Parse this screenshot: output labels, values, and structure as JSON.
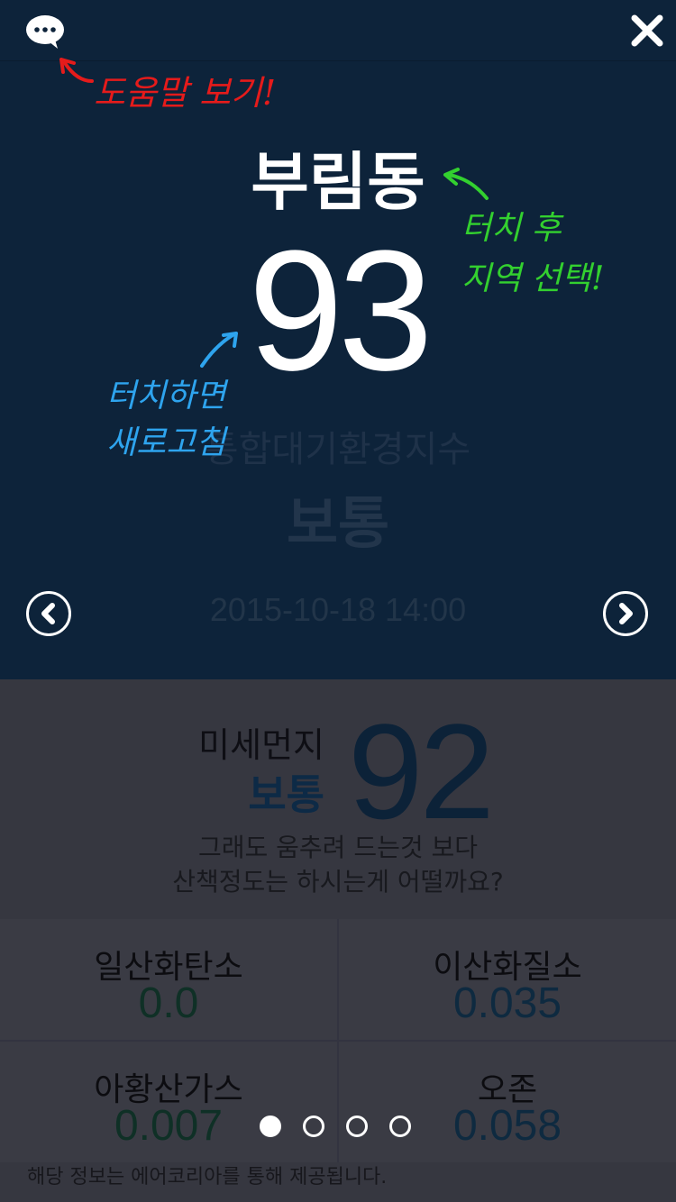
{
  "header": {
    "help_icon": "speech-bubble-icon",
    "close_icon": "close-icon"
  },
  "annotations": {
    "help_note": "도움말 보기!",
    "location_note_line1": "터치 후",
    "location_note_line2": "지역 선택!",
    "refresh_note_line1": "터치하면",
    "refresh_note_line2": "새로고침",
    "colors": {
      "red": "#e51b1b",
      "green": "#33d02f",
      "blue": "#2ea4ee"
    }
  },
  "main": {
    "location": "부림동",
    "aqi_value": "93",
    "aqi_label": "통합대기환경지수",
    "aqi_status": "보통",
    "timestamp": "2015-10-18 14:00",
    "prev_icon": "chevron-left-icon",
    "next_icon": "chevron-right-icon"
  },
  "dust": {
    "name": "미세먼지",
    "status": "보통",
    "value": "92",
    "message_line1": "그래도 움추려 드는것 보다",
    "message_line2": "산책정도는 하시는게 어떨까요?"
  },
  "pollutants": [
    {
      "name": "일산화탄소",
      "value": "0.0",
      "color": "#0f3026"
    },
    {
      "name": "이산화질소",
      "value": "0.035",
      "color": "#0e2a40"
    },
    {
      "name": "아황산가스",
      "value": "0.007",
      "color": "#0f3026"
    },
    {
      "name": "오존",
      "value": "0.058",
      "color": "#0e2a40"
    }
  ],
  "pager": {
    "count": 4,
    "active_index": 0
  },
  "footer": {
    "text": "해당 정보는 에어코리아를 통해 제공됩니다."
  }
}
